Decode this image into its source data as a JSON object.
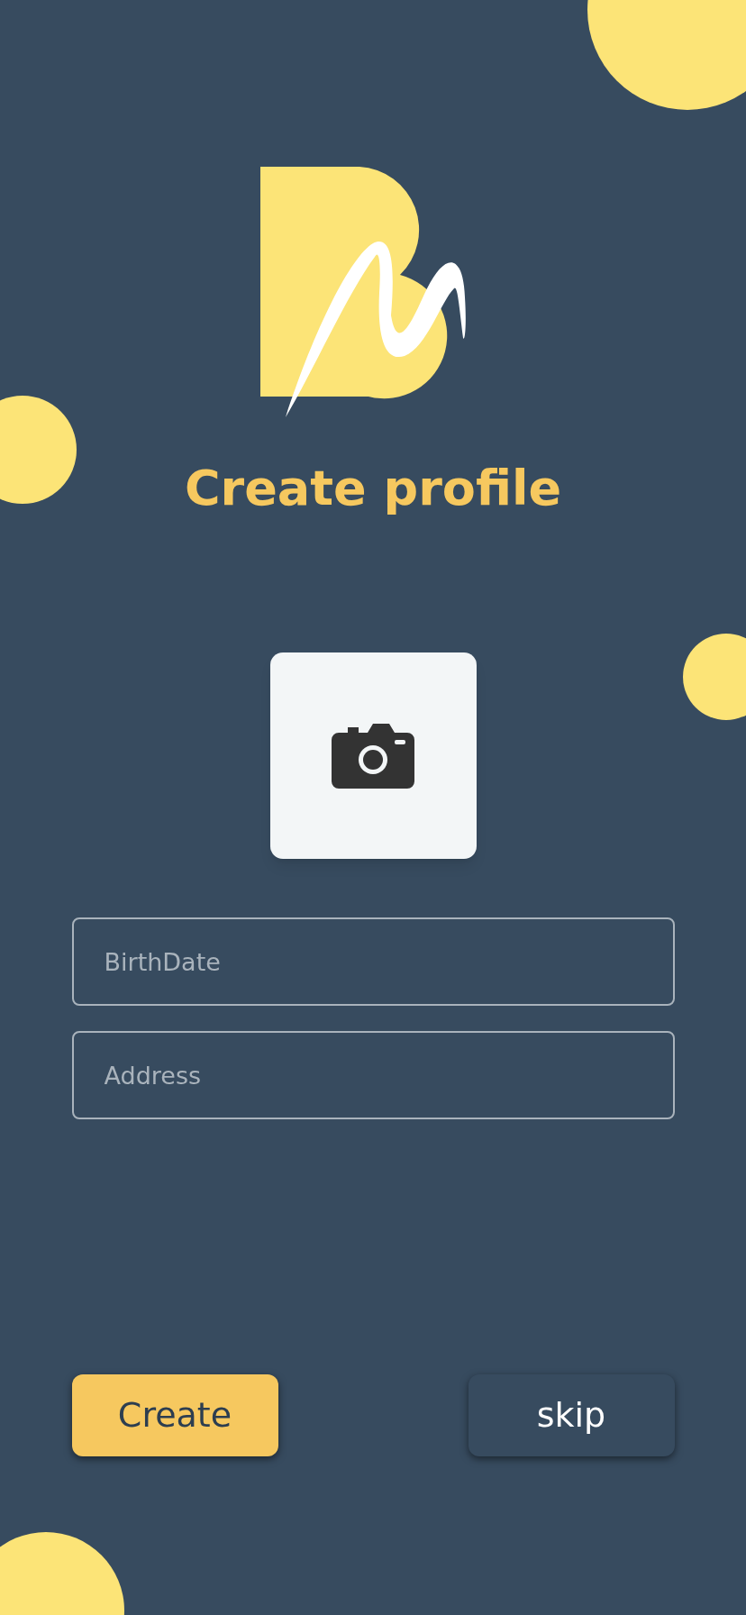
{
  "title": "Create profile",
  "photo_picker": {
    "kind": "camera"
  },
  "fields": [
    {
      "placeholder": "BirthDate"
    },
    {
      "placeholder": "Address"
    }
  ],
  "buttons": [
    {
      "label": "Create",
      "kind": "primary"
    },
    {
      "label": "skip",
      "kind": "secondary"
    }
  ]
}
